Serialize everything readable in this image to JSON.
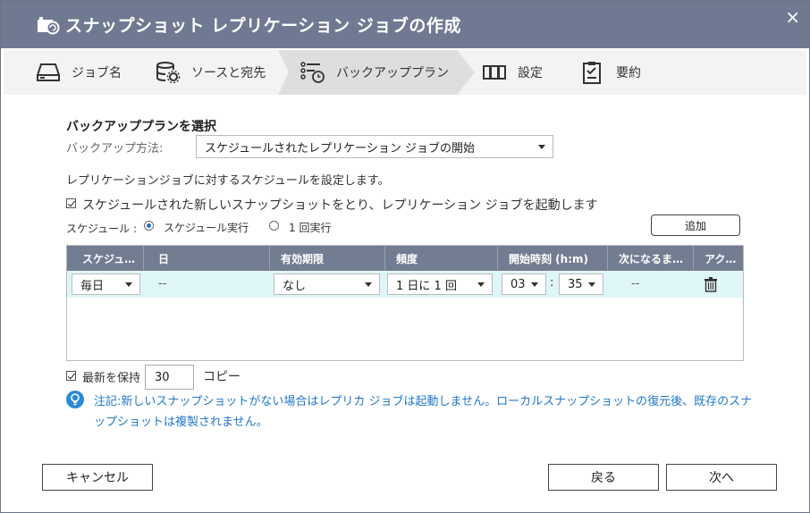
{
  "dialog": {
    "title": "スナップショット レプリケーション ジョブの作成",
    "close_glyph": "×"
  },
  "steps": [
    {
      "label": "ジョブ名",
      "icon": "drive-icon"
    },
    {
      "label": "ソースと宛先",
      "icon": "database-gear-icon"
    },
    {
      "label": "バックアッププラン",
      "icon": "schedule-list-icon",
      "active": true
    },
    {
      "label": "設定",
      "icon": "settings-tape-icon"
    },
    {
      "label": "要約",
      "icon": "clipboard-check-icon"
    }
  ],
  "plan": {
    "section_title": "バックアッププランを選択",
    "method_label": "バックアップ方法:",
    "method_value": "スケジュールされたレプリケーション ジョブの開始",
    "schedule_desc": "レプリケーションジョブに対するスケジュールを設定します。",
    "snapshot_checkbox_label": "スケジュールされた新しいスナップショットをとり、レプリケーション ジョブを起動します",
    "schedule_label": "スケジュール :",
    "radio_scheduled": "スケジュール実行",
    "radio_once": "1 回実行",
    "add_button": "追加"
  },
  "table": {
    "headers": [
      "スケジュ…",
      "日",
      "有効期限",
      "頻度",
      "開始時刻 (h:m)",
      "次になるま…",
      "アク…"
    ],
    "row": {
      "schedule": "毎日",
      "day": "--",
      "expiry": "なし",
      "frequency": "1 日に 1 回",
      "hour": "03",
      "colon": ":",
      "minute": "35",
      "next": "--"
    }
  },
  "retention": {
    "label": "最新を保持",
    "value": "30",
    "unit": "コピー"
  },
  "note": {
    "text": "注記:新しいスナップショットがない場合はレプリカ ジョブは起動しません。ローカルスナップショットの復元後、既存のスナップショットは複製されません。"
  },
  "footer": {
    "cancel": "キャンセル",
    "back": "戻る",
    "next": "次へ"
  },
  "colors": {
    "titlebar": "#6f7a92",
    "table_header": "#737d92",
    "row_highlight": "#dff6f8",
    "note_text": "#2277c9"
  }
}
